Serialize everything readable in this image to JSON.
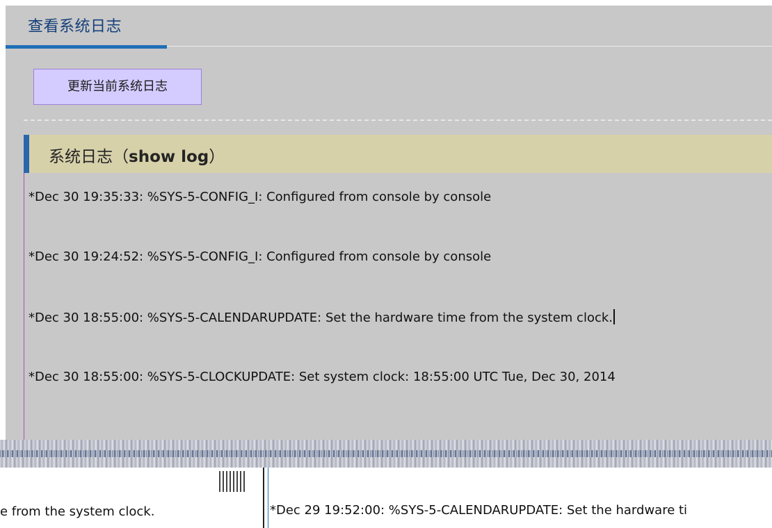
{
  "tab": {
    "title": "查看系统日志"
  },
  "toolbar": {
    "refresh_label": "更新当前系统日志"
  },
  "section": {
    "title_prefix": "系统日志（",
    "title_cmd": "show log",
    "title_suffix": "）"
  },
  "logs": [
    "*Dec 30 19:35:33: %SYS-5-CONFIG_I: Configured from console by console",
    "*Dec 30 19:24:52: %SYS-5-CONFIG_I: Configured from console by console",
    "*Dec 30 18:55:00: %SYS-5-CALENDARUPDATE: Set the hardware time from the system clock.",
    "*Dec 30 18:55:00: %SYS-5-CLOCKUPDATE: Set system clock: 18:55:00 UTC Tue, Dec 30, 2014"
  ],
  "lower": {
    "left_text": "e from the system clock.",
    "right_text": "*Dec 29 19:52:00: %SYS-5-CALENDARUPDATE: Set the hardware ti"
  },
  "colors": {
    "tab_accent": "#1f6fb7",
    "button_bg": "#d4ccff",
    "section_bg": "#d7d1aa",
    "panel_bg": "#c8c8c8"
  }
}
